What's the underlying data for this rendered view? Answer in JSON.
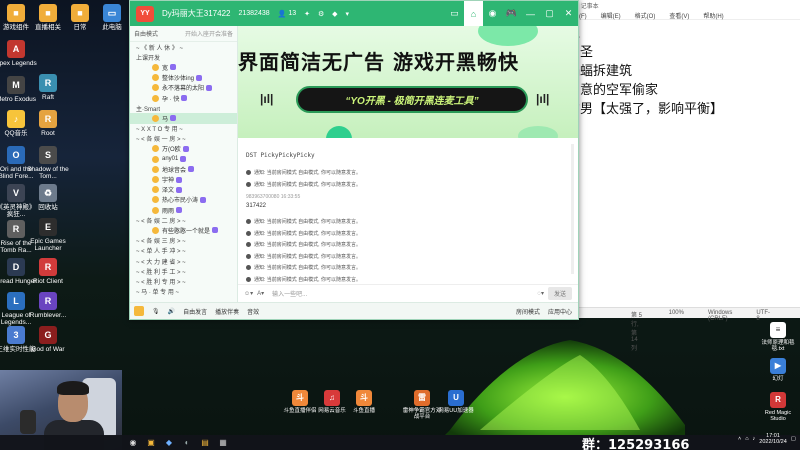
{
  "desktop_icons": [
    {
      "label": "游戏组件",
      "color": "#f0ad3a",
      "glyph": "■"
    },
    {
      "label": "Apex Legends",
      "color": "#c2372f",
      "glyph": "A"
    },
    {
      "label": "Metro Exodus",
      "color": "#444444",
      "glyph": "M"
    },
    {
      "label": "QQ音乐",
      "color": "#f7c43b",
      "glyph": "♪"
    },
    {
      "label": "Ori and the Blind Fore...",
      "color": "#2a6ab8",
      "glyph": "O"
    },
    {
      "label": "《英灵神殿》疯狂...",
      "color": "#3c4454",
      "glyph": "V"
    },
    {
      "label": "Rise of the Tomb Ra...",
      "color": "#5f5f5f",
      "glyph": "R"
    },
    {
      "label": "Dread Hunger",
      "color": "#2b3a52",
      "glyph": "D"
    },
    {
      "label": "League of Legends...",
      "color": "#2b6fbf",
      "glyph": "L"
    },
    {
      "label": "三维实时性能",
      "color": "#4a7bd0",
      "glyph": "3"
    },
    {
      "label": "直播相关",
      "color": "#f0ad3a",
      "glyph": "■"
    },
    {
      "label": "Raft",
      "color": "#3a8fb0",
      "glyph": "R"
    },
    {
      "label": "Root",
      "color": "#e5a340",
      "glyph": "R"
    },
    {
      "label": "Shadow of the Tom...",
      "color": "#4b4b4b",
      "glyph": "S"
    },
    {
      "label": "回收站",
      "color": "#6d7b8c",
      "glyph": "♻"
    },
    {
      "label": "Epic Games Launcher",
      "color": "#2d2d2d",
      "glyph": "E"
    },
    {
      "label": "Riot Client",
      "color": "#d13b3b",
      "glyph": "R"
    },
    {
      "label": "Rumblever...",
      "color": "#6a44c0",
      "glyph": "R"
    },
    {
      "label": "God of War",
      "color": "#8b1e1e",
      "glyph": "G"
    },
    {
      "label": "日常",
      "color": "#f0ad3a",
      "glyph": "■"
    },
    {
      "label": "此电脑",
      "color": "#3a86d6",
      "glyph": "▭"
    }
  ],
  "chat_window": {
    "logo": "YY",
    "room_title": "Dy玛丽大王317422",
    "room_id": "21382438",
    "online_count": "13",
    "title_icons": [
      "▭",
      "⌂",
      "◉",
      "🎮",
      "—",
      "▢",
      "✕"
    ],
    "channel_panel": {
      "mode_label": "自由模式",
      "header_hint": "开始入座开会准备",
      "rows": [
        {
          "text": "~ 《 新 人 休 》 ~",
          "type": "ch"
        },
        {
          "text": "上课开发",
          "type": "ch"
        },
        {
          "text": "宽",
          "type": "user"
        },
        {
          "text": "整体沙体ing",
          "type": "user"
        },
        {
          "text": "永不落幕的太阳",
          "type": "user"
        },
        {
          "text": "孕 · 快",
          "type": "user"
        },
        {
          "text": "主·Smart",
          "type": "ch"
        },
        {
          "text": "马",
          "type": "user",
          "highlight": true
        },
        {
          "text": "~ X X T O 专 用 ~",
          "type": "ch"
        },
        {
          "text": "~ < 各 娱 一 房 > ~",
          "type": "ch"
        },
        {
          "text": "万(O欧",
          "type": "user"
        },
        {
          "text": "any01",
          "type": "user"
        },
        {
          "text": "地球音会",
          "type": "user"
        },
        {
          "text": "宇神",
          "type": "user"
        },
        {
          "text": "泽文",
          "type": "user"
        },
        {
          "text": "热心市民小涛",
          "type": "user"
        },
        {
          "text": "雨雨",
          "type": "user"
        },
        {
          "text": "~ < 各 娱 二 房 > ~",
          "type": "ch"
        },
        {
          "text": "有些憨憨一个就是",
          "type": "user"
        },
        {
          "text": "~ < 各 娱 三 房 > ~",
          "type": "ch"
        },
        {
          "text": "~ < 单 人 手 冲 > ~",
          "type": "ch"
        },
        {
          "text": "~ < 大 力 建 省 > ~",
          "type": "ch"
        },
        {
          "text": "~ < 胜 利 手 工 > ~",
          "type": "ch"
        },
        {
          "text": "~ < 胜 利 专 用 > ~",
          "type": "ch"
        },
        {
          "text": "~ 马 · 单 专 用 ~",
          "type": "ch"
        }
      ]
    },
    "banner": {
      "headline": "界面简洁无广告  游戏开黑畅快",
      "pill": "“YO开黑 - 极简开黑连麦工具”"
    },
    "messages": {
      "room_name": "DST PickyPickyPicky",
      "notices_top": [
        "通知:  当前房间模式 自由模式, 你可以随意发言。",
        "通知:  当前房间模式 自由模式, 你可以随意发言。"
      ],
      "sender_id": "983963700080   16:33:55",
      "number": "317422",
      "notices_bottom": [
        "通知:  当前房间模式 自由模式, 你可以随意发言。",
        "通知:  当前房间模式 自由模式, 你可以随意发言。",
        "通知:  当前房间模式 自由模式, 你可以随意发言。",
        "通知:  当前房间模式 自由模式, 你可以随意发言。",
        "通知:  当前房间模式 自由模式, 你可以随意发言。",
        "通知:  当前房间模式 自由模式, 你可以随意发言。",
        "通知:  当前房间模式 自由模式, 你可以随意发言。"
      ]
    },
    "input": {
      "placeholder": "输入一些吧...",
      "send": "发送"
    },
    "bottom_bar": {
      "free": "自由发言",
      "play_music": "播放伴奏",
      "audio": "音效",
      "mode": "房间模式",
      "app": "应用中心"
    }
  },
  "notepad": {
    "title": "Txt - 记事本",
    "menu": [
      "文件(F)",
      "编辑(E)",
      "格式(O)",
      "查看(V)",
      "帮助(H)"
    ],
    "lines": [
      "位",
      "刺圣",
      "蝙蝠拆建筑",
      "刺意的空军偷家",
      "狗男【太强了，影响平衡】"
    ],
    "status": {
      "pos": "第 5 行, 第 14 列",
      "zoom": "100%",
      "eol": "Windows (CRLF)",
      "enc": "UTF-8"
    }
  },
  "dock_icons": [
    {
      "label": "斗鱼直播伴侣",
      "color": "#f0883a",
      "glyph": "斗"
    },
    {
      "label": "网易云音乐",
      "color": "#d83a3a",
      "glyph": "♫"
    },
    {
      "label": "斗鱼直播",
      "color": "#f0883a",
      "glyph": "斗"
    },
    {
      "label": "雷神争霸官方对战平台",
      "color": "#e06d2c",
      "glyph": "雷"
    },
    {
      "label": "网易UU加速器",
      "color": "#2a6ed0",
      "glyph": "U"
    }
  ],
  "right_desktop_icons": [
    {
      "label": "法师原理和毯毯.txt",
      "color": "#ffffff",
      "glyph": "≡"
    },
    {
      "label": "幻灯",
      "color": "#3a7fd8",
      "glyph": "▶"
    },
    {
      "label": "Red Magic Studio",
      "color": "#d23838",
      "glyph": "R"
    }
  ],
  "taskbar": {
    "group_number": "群：125293166",
    "time": "17:01",
    "date": "2022/10/24"
  }
}
